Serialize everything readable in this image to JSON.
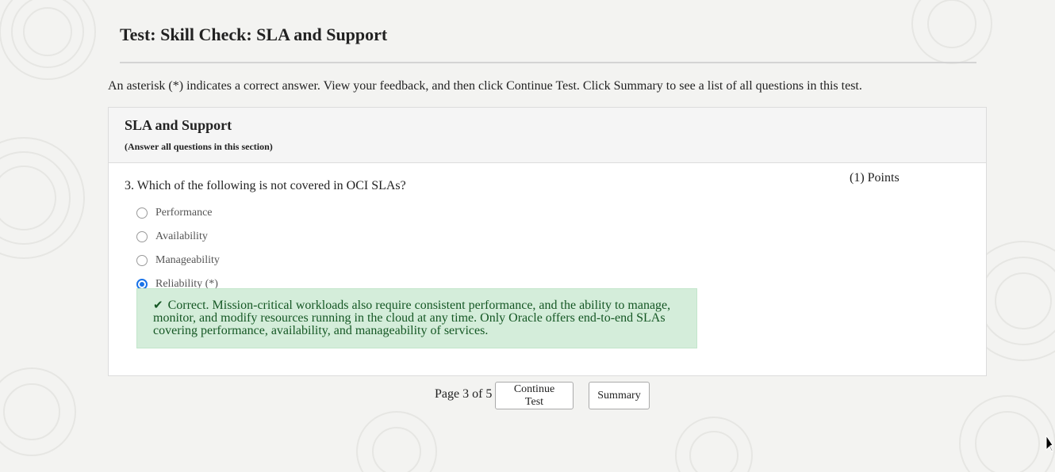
{
  "page": {
    "title": "Test: Skill Check: SLA and Support",
    "instructions": "An asterisk (*) indicates a correct answer. View your feedback, and then click Continue Test. Click Summary to see a list of all questions in this test."
  },
  "section": {
    "title": "SLA and Support",
    "subtitle": "(Answer all questions in this section)"
  },
  "question": {
    "text": "3. Which of the following is not covered in OCI SLAs?",
    "points": "(1) Points",
    "options": [
      {
        "label": "Performance",
        "selected": false
      },
      {
        "label": "Availability",
        "selected": false
      },
      {
        "label": "Manageability",
        "selected": false
      },
      {
        "label": "Reliability (*)",
        "selected": true
      }
    ],
    "feedback": {
      "icon": "check-icon",
      "text": "Correct. Mission-critical workloads also require consistent performance, and the ability to manage, monitor, and modify resources running in the cloud at any time. Only Oracle offers end-to-end SLAs covering performance, availability, and manageability of services."
    }
  },
  "footer": {
    "page_indicator": "Page 3 of 5",
    "continue_label": "Continue Test",
    "summary_label": "Summary"
  },
  "colors": {
    "accent": "#1a73e8",
    "success_bg": "#d4edda",
    "success_text": "#155724"
  }
}
